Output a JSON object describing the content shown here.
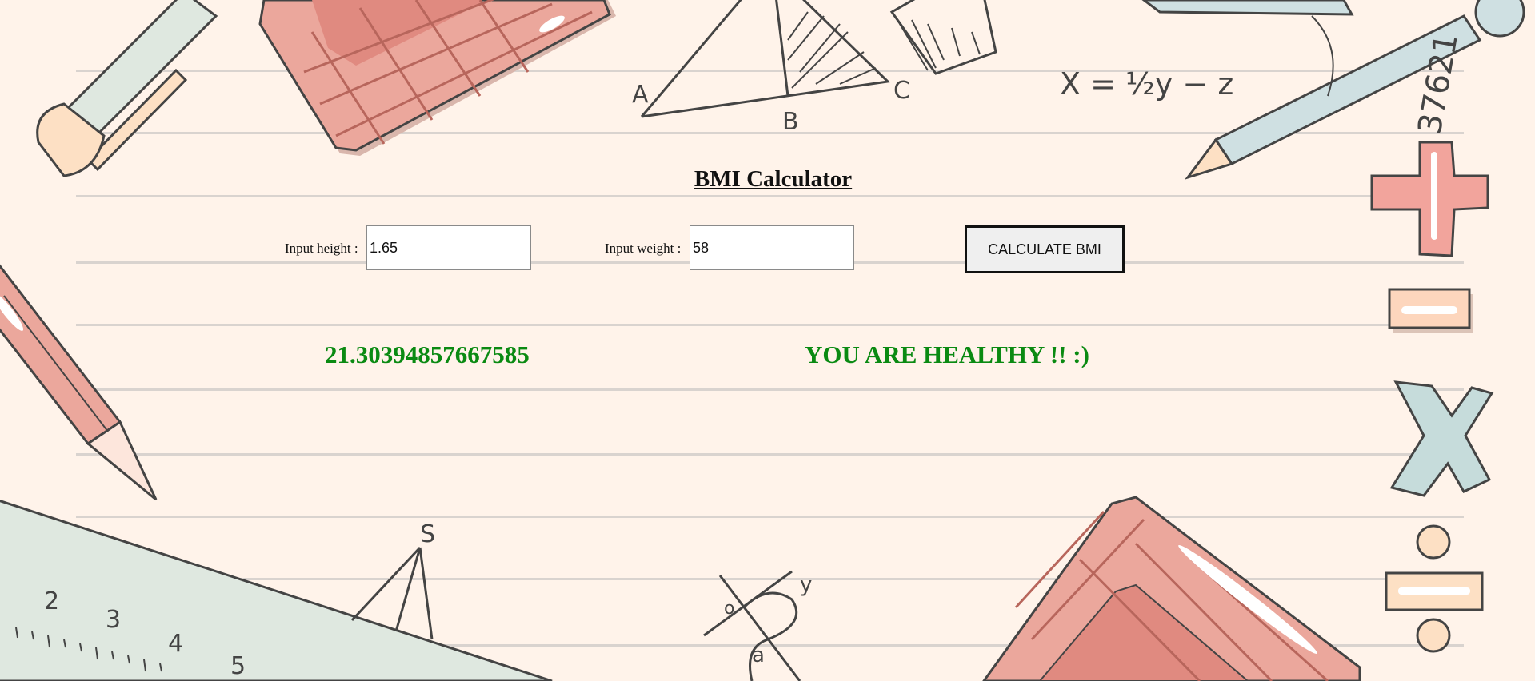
{
  "title": "BMI Calculator",
  "form": {
    "height_label": "Input height :",
    "height_value": "1.65",
    "weight_label": "Input weight :",
    "weight_value": "58",
    "button_label": "CALCULATE BMI"
  },
  "result": {
    "bmi_value": "21.30394857667585",
    "status_message": "YOU ARE HEALTHY !! :)"
  },
  "decor_text": {
    "triangle_a": "A",
    "triangle_b": "B",
    "triangle_c": "C",
    "equation": "X = ½y − z",
    "ruler_2": "2",
    "ruler_3": "3",
    "ruler_4": "4",
    "ruler_5": "5",
    "graph_y": "y",
    "graph_o": "o",
    "graph_a": "a",
    "label_s": "S",
    "number_37621": "37621"
  },
  "colors": {
    "background": "#fff3ea",
    "result_green": "#0a8a12",
    "pink": "#eba79c",
    "mint": "#dfe8e0",
    "peach": "#fde0c4"
  }
}
